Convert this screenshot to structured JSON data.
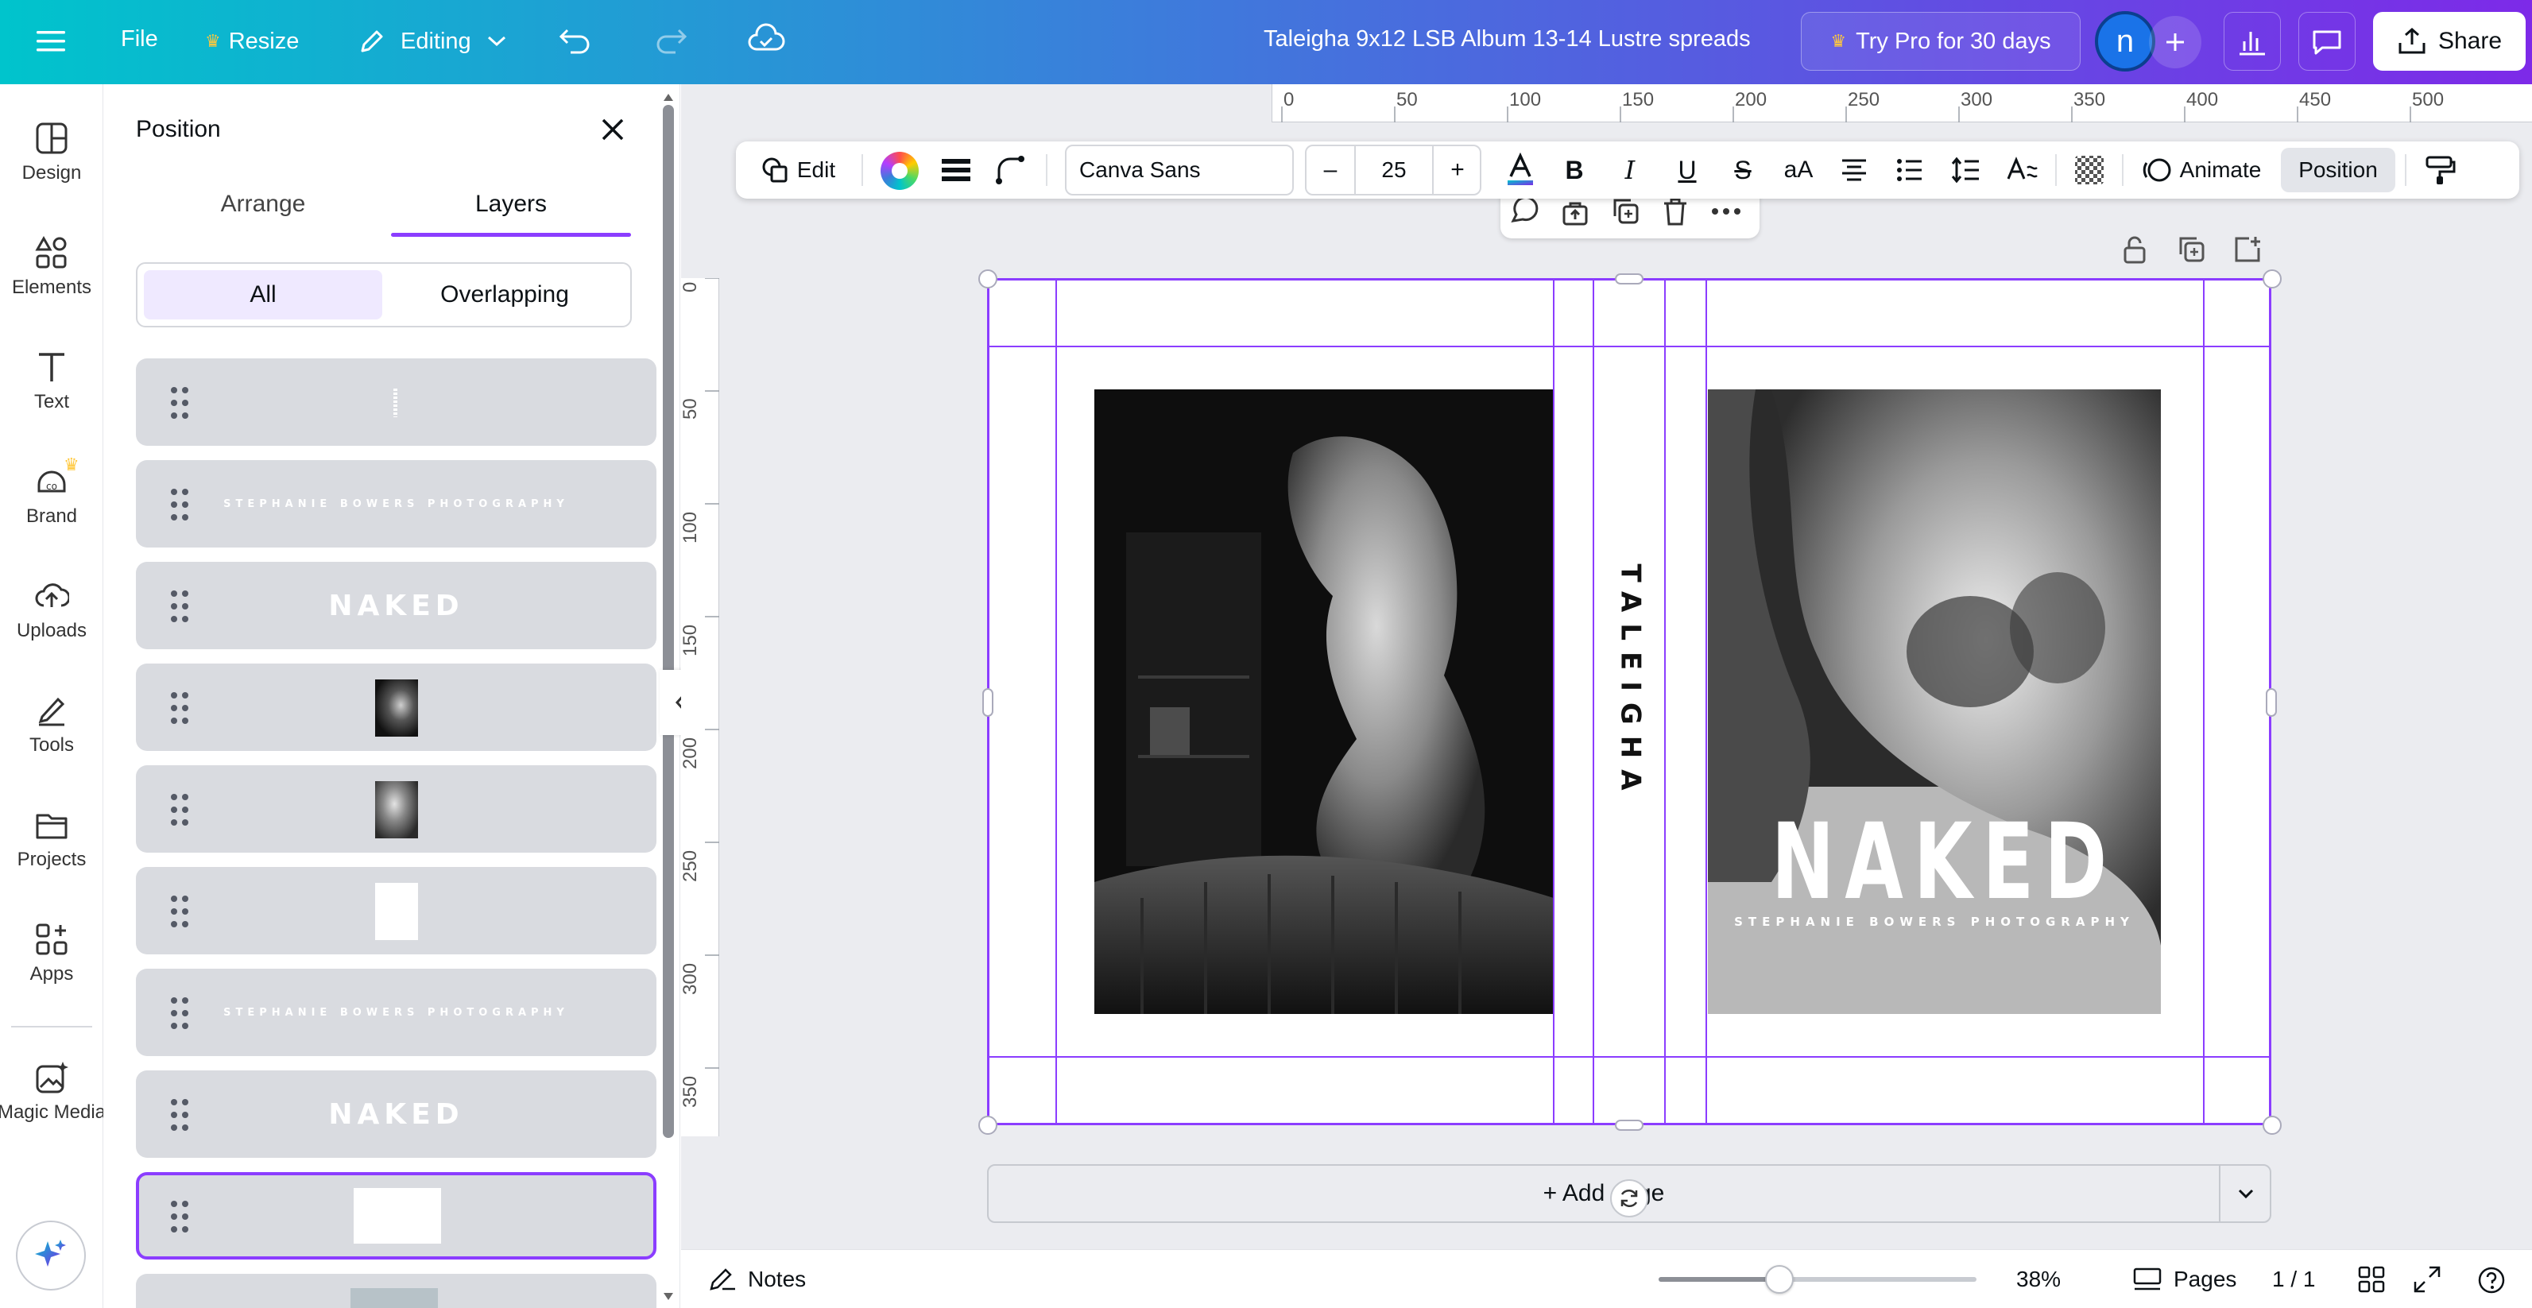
{
  "topbar": {
    "file": "File",
    "resize": "Resize",
    "editing": "Editing",
    "doc_title": "Taleigha 9x12 LSB Album 13-14 Lustre spreads",
    "try_pro": "Try Pro for 30 days",
    "avatar_initial": "n",
    "share": "Share"
  },
  "rail": [
    {
      "label": "Design",
      "icon": "design-icon"
    },
    {
      "label": "Elements",
      "icon": "elements-icon"
    },
    {
      "label": "Text",
      "icon": "text-icon"
    },
    {
      "label": "Brand",
      "icon": "brand-icon"
    },
    {
      "label": "Uploads",
      "icon": "uploads-icon"
    },
    {
      "label": "Tools",
      "icon": "tools-icon"
    },
    {
      "label": "Projects",
      "icon": "projects-icon"
    },
    {
      "label": "Apps",
      "icon": "apps-icon"
    },
    {
      "label": "Magic Media",
      "icon": "magic-media-icon"
    }
  ],
  "panel": {
    "title": "Position",
    "tabs": [
      "Arrange",
      "Layers"
    ],
    "active_tab": "Layers",
    "filters": [
      "All",
      "Overlapping"
    ],
    "active_filter": "All",
    "layers": [
      {
        "kind": "text-vertical",
        "text": "TALEIGHA"
      },
      {
        "kind": "text-small",
        "text": "STEPHANIE BOWERS PHOTOGRAPHY"
      },
      {
        "kind": "text-big",
        "text": "NAKED"
      },
      {
        "kind": "photo"
      },
      {
        "kind": "photo"
      },
      {
        "kind": "white-rect"
      },
      {
        "kind": "text-small",
        "text": "STEPHANIE BOWERS PHOTOGRAPHY"
      },
      {
        "kind": "text-big",
        "text": "NAKED"
      },
      {
        "kind": "white-wide",
        "selected": true
      },
      {
        "kind": "partial"
      }
    ]
  },
  "ruler": {
    "h": [
      "0",
      "50",
      "100",
      "150",
      "200",
      "250",
      "300",
      "350",
      "400",
      "450",
      "500"
    ],
    "v": [
      "0",
      "50",
      "100",
      "150",
      "200",
      "250",
      "300",
      "350"
    ]
  },
  "toolbar": {
    "edit": "Edit",
    "font": "Canva Sans",
    "font_size": "25",
    "minus": "–",
    "plus": "+",
    "animate": "Animate",
    "position": "Position"
  },
  "design": {
    "spine_text": "TALEIGHA",
    "headline": "NAKED",
    "subline": "STEPHANIE BOWERS PHOTOGRAPHY"
  },
  "add_page": "+ Add page",
  "bottombar": {
    "notes": "Notes",
    "zoom": "38%",
    "zoom_fraction": 0.38,
    "pages": "Pages",
    "page_count": "1 / 1"
  },
  "colors": {
    "brand_teal": "#00c4cc",
    "brand_purple": "#7d2ae8",
    "selection": "#8b3dff"
  }
}
